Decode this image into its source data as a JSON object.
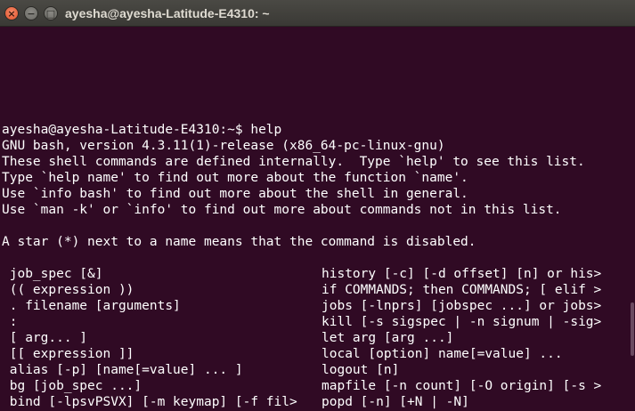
{
  "window": {
    "title": "ayesha@ayesha-Latitude-E4310: ~",
    "buttons": {
      "close": "×",
      "minimize": "−",
      "maximize": "□"
    }
  },
  "terminal": {
    "background": "#300a24",
    "foreground": "#ffffff",
    "lines": [
      "ayesha@ayesha-Latitude-E4310:~$ help",
      "GNU bash, version 4.3.11(1)-release (x86_64-pc-linux-gnu)",
      "These shell commands are defined internally.  Type `help' to see this list.",
      "Type `help name' to find out more about the function `name'.",
      "Use `info bash' to find out more about the shell in general.",
      "Use `man -k' or `info' to find out more about commands not in this list.",
      "",
      "A star (*) next to a name means that the command is disabled.",
      ""
    ],
    "commands_left": [
      " job_spec [&]",
      " (( expression ))",
      " . filename [arguments]",
      " :",
      " [ arg... ]",
      " [[ expression ]]",
      " alias [-p] [name[=value] ... ]",
      " bg [job_spec ...]",
      " bind [-lpsvPSVX] [-m keymap] [-f fil>"
    ],
    "commands_right": [
      "history [-c] [-d offset] [n] or his>",
      "if COMMANDS; then COMMANDS; [ elif >",
      "jobs [-lnprs] [jobspec ...] or jobs>",
      "kill [-s sigspec | -n signum | -sig>",
      "let arg [arg ...]",
      "local [option] name[=value] ...",
      "logout [n]",
      "mapfile [-n count] [-O origin] [-s >",
      "popd [-n] [+N | -N]"
    ]
  }
}
